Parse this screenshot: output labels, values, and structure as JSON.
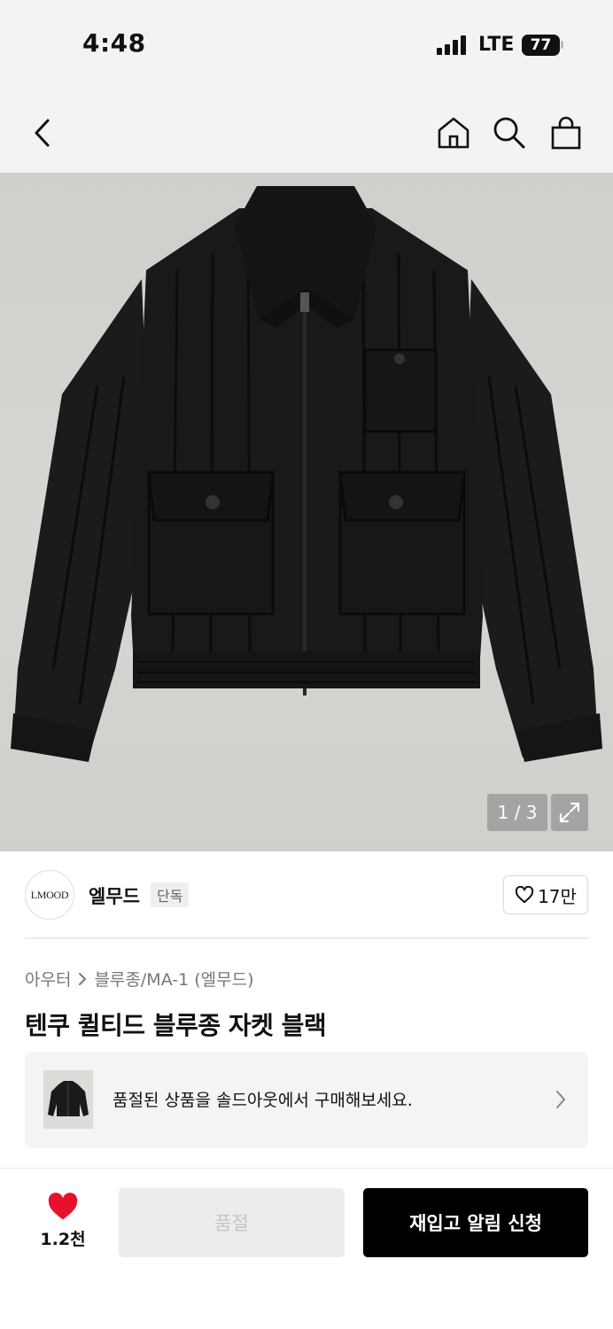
{
  "status_bar": {
    "time": "4:48",
    "network": "LTE",
    "battery": "77"
  },
  "nav": {
    "back_icon": "chevron-left-icon",
    "home_icon": "home-icon",
    "search_icon": "search-icon",
    "cart_icon": "shopping-bag-icon"
  },
  "image": {
    "counter": "1 / 3",
    "expand_icon": "expand-icon"
  },
  "brand": {
    "logo_text": "LMOOD",
    "name": "엘무드",
    "badge": "단독",
    "likes": "17만"
  },
  "breadcrumb": {
    "category": "아우터",
    "subcategory": "블루종/MA-1 (엘무드)"
  },
  "product": {
    "title": "텐쿠 퀼티드 블루종 자켓 블랙"
  },
  "soldout_banner": {
    "text": "품절된 상품을 솔드아웃에서 구매해보세요."
  },
  "bottom_bar": {
    "wish_count": "1.2천",
    "soldout_label": "품절",
    "restock_label": "재입고 알림 신청"
  },
  "colors": {
    "accent": "#e8112d",
    "primary_button": "#000000",
    "disabled_button": "#ececec"
  }
}
